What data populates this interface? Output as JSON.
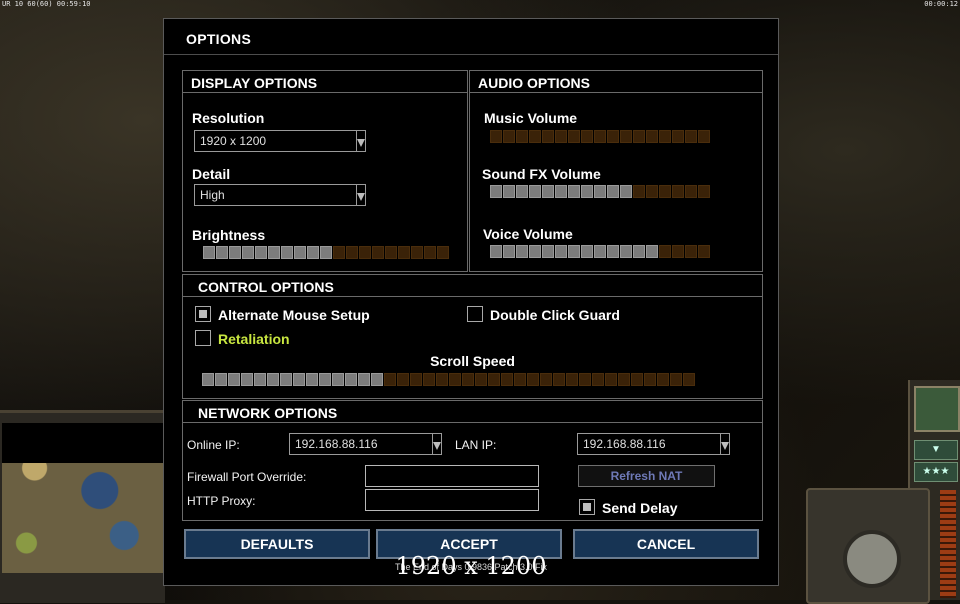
{
  "hud": {
    "top_left": "UR 10 60(60) 00:59:10",
    "top_right": "00:00:12"
  },
  "dialog": {
    "title": "OPTIONS",
    "display": {
      "header": "DISPLAY OPTIONS",
      "resolution_label": "Resolution",
      "resolution_value": "1920 x 1200",
      "detail_label": "Detail",
      "detail_value": "High",
      "brightness_label": "Brightness",
      "brightness_level": 0.53
    },
    "audio": {
      "header": "AUDIO OPTIONS",
      "music_label": "Music Volume",
      "music_level": 0.0,
      "sfx_label": "Sound FX Volume",
      "sfx_level": 0.65,
      "voice_label": "Voice Volume",
      "voice_level": 0.76
    },
    "control": {
      "header": "CONTROL OPTIONS",
      "alt_mouse_label": "Alternate Mouse Setup",
      "alt_mouse_checked": true,
      "double_click_label": "Double Click Guard",
      "double_click_checked": false,
      "retaliation_label": "Retaliation",
      "retaliation_checked": false,
      "retaliation_color": "#c8e640",
      "scroll_label": "Scroll Speed",
      "scroll_level": 0.37
    },
    "network": {
      "header": "NETWORK OPTIONS",
      "online_ip_label": "Online IP:",
      "online_ip_value": "192.168.88.116",
      "lan_ip_label": "LAN IP:",
      "lan_ip_value": "192.168.88.116",
      "firewall_label": "Firewall Port Override:",
      "firewall_value": "",
      "http_proxy_label": "HTTP Proxy:",
      "http_proxy_value": "",
      "refresh_nat_label": "Refresh NAT",
      "send_delay_label": "Send Delay",
      "send_delay_checked": true
    },
    "buttons": {
      "defaults": "DEFAULTS",
      "accept": "ACCEPT",
      "cancel": "CANCEL"
    },
    "footer_text": "The End of Days 0.9836 Patch 3.0 Fix",
    "overlay_resolution": "1920 x 1200"
  },
  "colors": {
    "slider_on": "#7c7c7c",
    "slider_off": "#3a2208",
    "button_bg": "#173454"
  }
}
